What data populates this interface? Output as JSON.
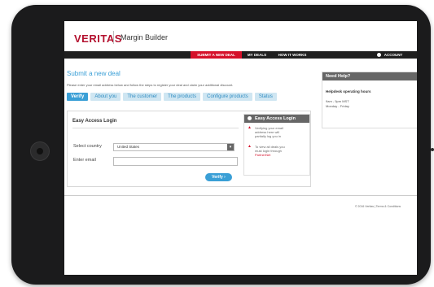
{
  "brand": {
    "logo": "VERITAS",
    "product": "Margin Builder"
  },
  "nav": {
    "items": [
      "SUBMIT A NEW DEAL",
      "MY DEALS",
      "HOW IT WORKS"
    ],
    "account": "ACCOUNT"
  },
  "page": {
    "title": "Submit a new deal",
    "intro": "Please enter your email address below and follow the steps to register your deal and claim your additional discount."
  },
  "steps": [
    "Verify",
    "About you",
    "The customer",
    "The products",
    "Configure products",
    "Status"
  ],
  "login": {
    "title": "Easy Access Login",
    "country_label": "Select country",
    "country_value": "United States",
    "email_label": "Enter email",
    "email_value": "",
    "verify_label": "Verify",
    "verify_arrow": "›"
  },
  "eal_panel": {
    "title": "Easy Access Login",
    "item1": "Verifying your email address here will partially log you in",
    "item2_text": "To view all deals you must login through",
    "item2_link": "PartnerNet"
  },
  "help": {
    "title": "Need Help?",
    "subtitle": "Helpdesk operating hours",
    "hours": "9am - 5pm MST",
    "days": "Monday - Friday"
  },
  "footer": {
    "text": "© 2016 Veritas | Terms & Conditions"
  },
  "colors": {
    "brand_red": "#d5102a",
    "accent_blue": "#3a9fd6",
    "nav_dark": "#1f1f1f"
  },
  "icons": {
    "warning": "warning-icon",
    "info": "info-dot-icon",
    "dropdown": "chevron-down-icon"
  }
}
